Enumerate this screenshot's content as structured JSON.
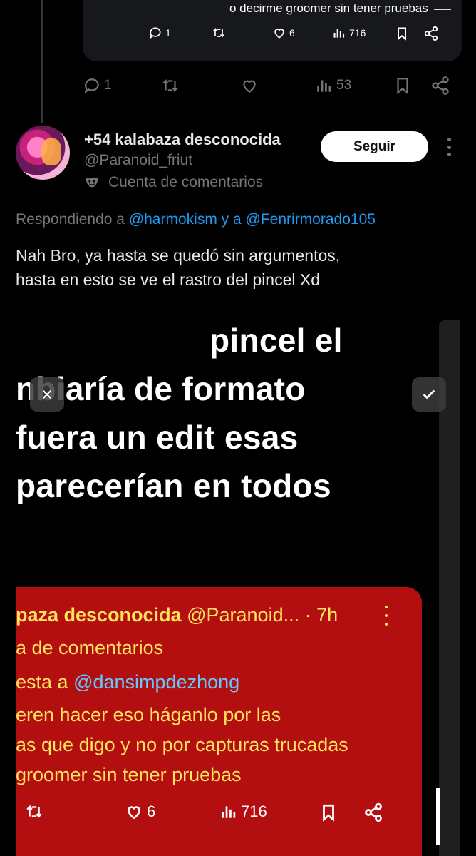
{
  "quoted_card": {
    "snippet": "o decirme groomer sin tener pruebas",
    "replies": "1",
    "likes": "6",
    "views": "716"
  },
  "parent_actions": {
    "replies": "1",
    "views": "53"
  },
  "reply": {
    "display_name": "+54 kalabaza desconocida",
    "handle": "@Paranoid_friut",
    "badge_label": "Cuenta de comentarios",
    "follow_label": "Seguir",
    "replying_prefix": "Respondiendo a",
    "mention_1": "@harmokism",
    "mention_connector": "y a",
    "mention_2": "@Fenrirmorado105",
    "text_line_1": "Nah Bro, ya hasta se quedó sin argumentos,",
    "text_line_2": "hasta en esto se ve el rastro del pincel Xd"
  },
  "media": {
    "big_text": [
      "pincel el",
      "nbiaría de formato",
      "fuera un edit esas",
      "parecerían en todos"
    ],
    "red_card": {
      "name": "paza desconocida",
      "handle_time": "@Paranoid... · 7h",
      "badge": "a de comentarios",
      "reply_prefix": "esta a",
      "reply_mention": "@dansimpdezhong",
      "line_1": "eren hacer eso háganlo por las",
      "line_2": "as que digo y no por capturas trucadas",
      "line_3": "groomer sin tener pruebas",
      "likes": "6",
      "views": "716"
    }
  },
  "icons": {
    "reply": "reply-icon",
    "retweet": "retweet-icon",
    "like": "heart-icon",
    "views": "views-icon",
    "bookmark": "bookmark-icon",
    "share": "share-icon",
    "mask": "mask-icon",
    "more": "more-icon",
    "close": "close-icon",
    "check": "check-icon"
  },
  "colors": {
    "background": "#000000",
    "link": "#1d9bf0",
    "secondary_text": "#71767b",
    "red_card": "#b30e10",
    "red_card_text": "#ffe45c"
  }
}
